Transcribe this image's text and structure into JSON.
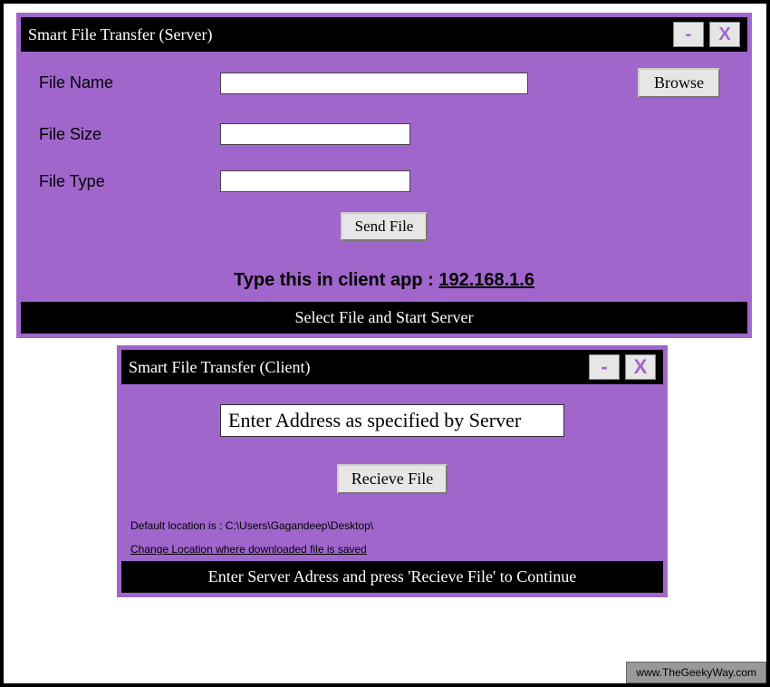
{
  "server": {
    "title": "Smart File Transfer (Server)",
    "minimize": "-",
    "close": "X",
    "labels": {
      "filename": "File Name",
      "filesize": "File Size",
      "filetype": "File Type"
    },
    "values": {
      "filename": "",
      "filesize": "",
      "filetype": ""
    },
    "browse": "Browse",
    "send": "Send File",
    "ip_prompt": "Type this in client app : ",
    "ip": "192.168.1.6",
    "status": "Select File and Start Server"
  },
  "client": {
    "title": "Smart File Transfer (Client)",
    "minimize": "-",
    "close": "X",
    "address_value": "Enter Address as specified by Server",
    "receive": "Recieve File",
    "default_location": "Default location is : C:\\Users\\Gagandeep\\Desktop\\",
    "change_location": "Change Location where downloaded file is saved ",
    "status": "Enter Server Adress and press 'Recieve File' to Continue"
  },
  "watermark": "www.TheGeekyWay.com"
}
